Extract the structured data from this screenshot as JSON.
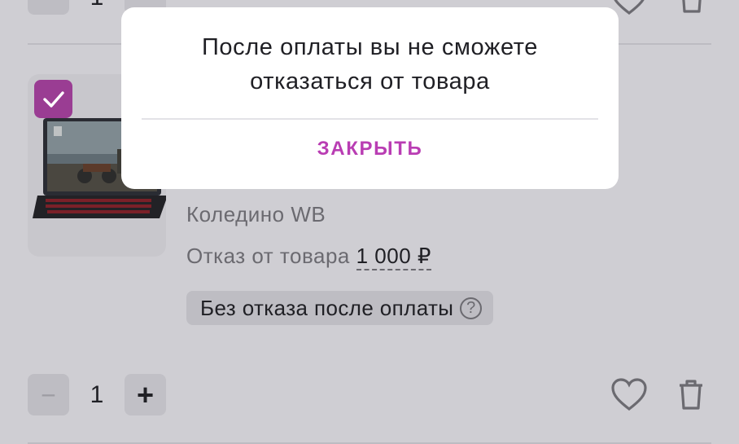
{
  "cart_item_prev": {
    "quantity": "1"
  },
  "cart_item": {
    "selected": true,
    "warehouse": "Коледино WB",
    "refund_label": "Отказ от товара",
    "refund_price": "1 000 ₽",
    "badge_label": "Без отказа после оплаты",
    "help_symbol": "?",
    "quantity": "1",
    "minus_symbol": "−",
    "plus_symbol": "+",
    "image": "laptop-product-image"
  },
  "modal": {
    "message": "После оплаты вы не сможете отказаться от товара",
    "close_label": "ЗАКРЫТЬ"
  },
  "colors": {
    "accent": "#b93db3",
    "checkbox": "#9a3d93",
    "overlay_bg": "#cfced3"
  },
  "icons": {
    "favorite": "heart-icon",
    "delete": "trash-icon",
    "checkbox": "checkmark-icon",
    "help": "help-icon"
  }
}
